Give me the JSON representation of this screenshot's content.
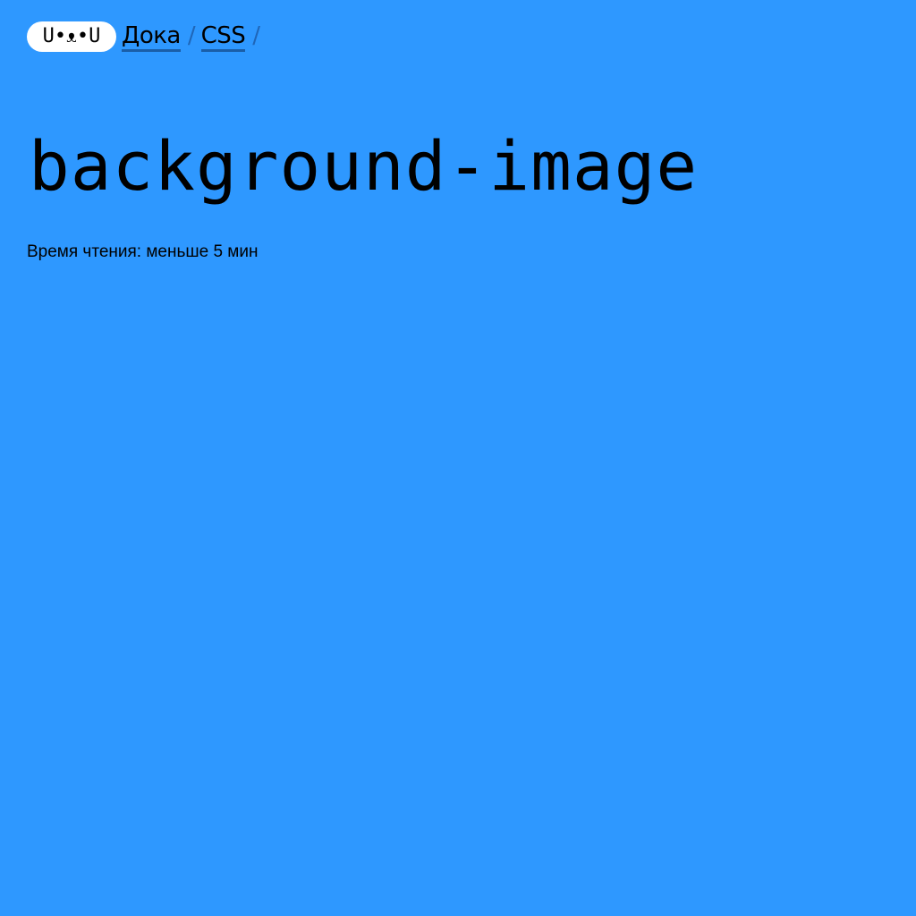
{
  "header": {
    "logo_text": "U•ᴥ•U",
    "breadcrumbs": [
      {
        "label": "Дока"
      },
      {
        "label": "CSS"
      }
    ],
    "separator": "/"
  },
  "article": {
    "title": "background-image",
    "reading_time": "Время чтения: меньше 5 мин"
  },
  "colors": {
    "background": "#2e98ff",
    "logo_background": "#ffffff",
    "text": "#000000",
    "link_underline": "#1a5ea8"
  }
}
